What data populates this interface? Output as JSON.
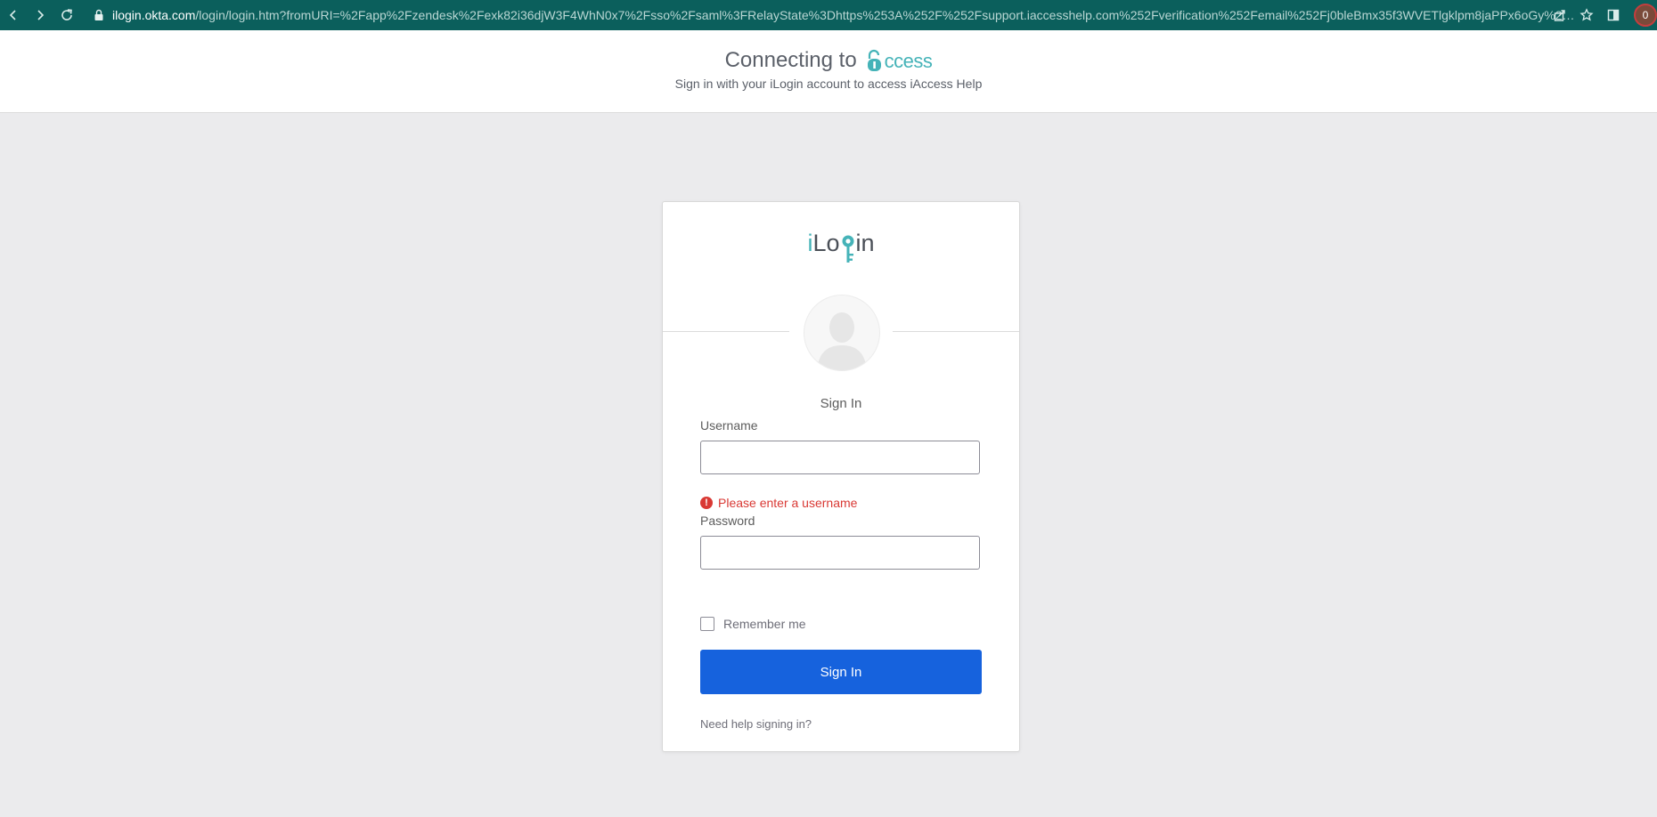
{
  "browser": {
    "url_host": "ilogin.okta.com",
    "url_rest": "/login/login.htm?fromURI=%2Fapp%2Fzendesk%2Fexk82i36djW3F4WhN0x7%2Fsso%2Fsaml%3FRelayState%3Dhttps%253A%252F%252Fsupport.iaccesshelp.com%252Fverification%252Femail%252Fj0bleBmx35f3WVETlgklpm8jaPPx6oGy%26br...",
    "profile_initial": "0"
  },
  "header": {
    "connecting_text": "Connecting to",
    "access_logo_text": "ccess",
    "subtitle": "Sign in with your iLogin account to access iAccess Help"
  },
  "card": {
    "logo": {
      "prefix": "i",
      "text_before_key": "Lo",
      "text_after_key": "in"
    },
    "title": "Sign In",
    "username": {
      "label": "Username",
      "value": "",
      "placeholder": "",
      "error": "Please enter a username"
    },
    "password": {
      "label": "Password",
      "value": "",
      "placeholder": ""
    },
    "remember_me": {
      "label": "Remember me",
      "checked": false
    },
    "submit_label": "Sign In",
    "help_link": "Need help signing in?"
  },
  "colors": {
    "toolbar": "#0b5f5c",
    "brand_teal": "#45b3b8",
    "primary_button": "#1662dd",
    "error": "#d93934",
    "page_background": "#ebebed"
  }
}
